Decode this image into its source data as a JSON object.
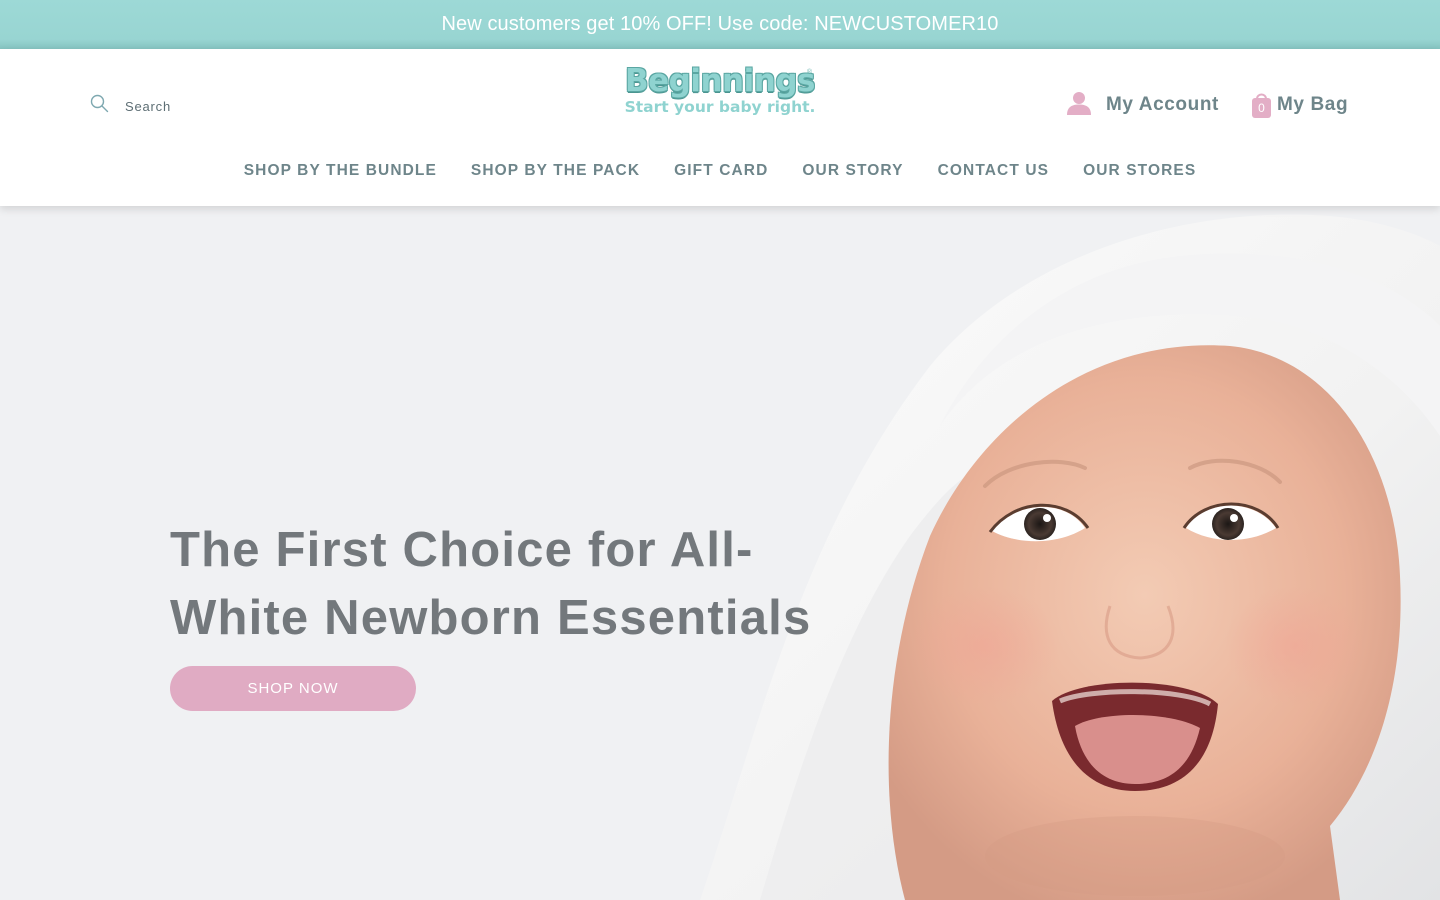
{
  "promo": {
    "text": "New customers get 10% OFF! Use code: NEWCUSTOMER10"
  },
  "header": {
    "search": {
      "label": "Search",
      "icon": "search-icon"
    },
    "logo": {
      "name": "Beginnings",
      "tagline": "Start your baby right.",
      "mark": "®"
    },
    "account": {
      "label": "My Account",
      "icon": "user-icon"
    },
    "bag": {
      "label": "My Bag",
      "count": "0",
      "icon": "shopping-bag-icon"
    }
  },
  "nav": {
    "items": [
      {
        "label": "SHOP BY THE BUNDLE"
      },
      {
        "label": "SHOP BY THE PACK"
      },
      {
        "label": "GIFT CARD"
      },
      {
        "label": "OUR STORY"
      },
      {
        "label": "CONTACT US"
      },
      {
        "label": "OUR STORES"
      }
    ]
  },
  "hero": {
    "title_line1": "The First Choice for All-",
    "title_line2": "White Newborn Essentials",
    "button_label": "SHOP NOW",
    "image_alt": "smiling-baby-in-white-towel"
  },
  "colors": {
    "promo_bg": "#9dd9d6",
    "accent_teal": "#8fd3d0",
    "nav_text": "#6e858a",
    "pink": "#e0abc3",
    "hero_bg": "#f0f1f3",
    "hero_text": "#73787c"
  }
}
